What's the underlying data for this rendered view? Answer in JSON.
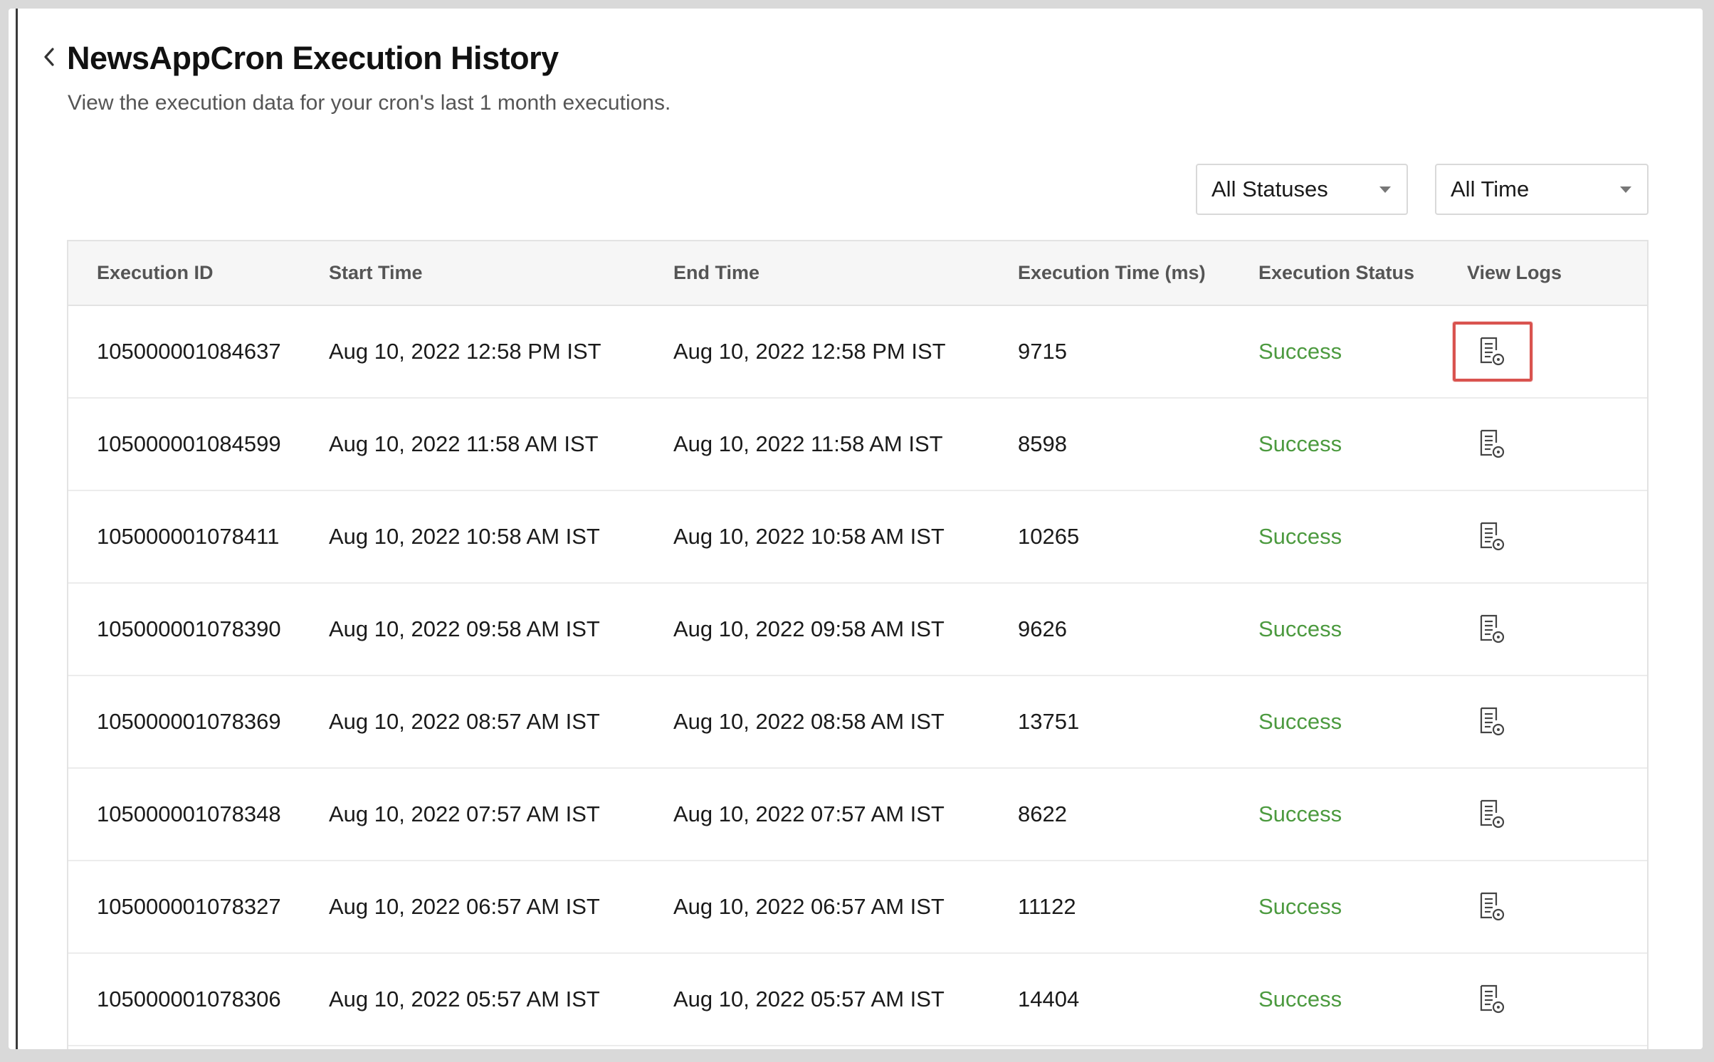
{
  "header": {
    "title": "NewsAppCron Execution History",
    "subtitle": "View the execution data for your cron's last 1 month executions."
  },
  "filters": {
    "status": {
      "selected": "All Statuses"
    },
    "time": {
      "selected": "All Time"
    }
  },
  "table": {
    "columns": [
      "Execution ID",
      "Start Time",
      "End Time",
      "Execution Time (ms)",
      "Execution Status",
      "View Logs"
    ],
    "rows": [
      {
        "id": "105000001084637",
        "start": "Aug 10, 2022 12:58 PM IST",
        "end": "Aug 10, 2022 12:58 PM IST",
        "ms": "9715",
        "status": "Success"
      },
      {
        "id": "105000001084599",
        "start": "Aug 10, 2022 11:58 AM IST",
        "end": "Aug 10, 2022 11:58 AM IST",
        "ms": "8598",
        "status": "Success"
      },
      {
        "id": "105000001078411",
        "start": "Aug 10, 2022 10:58 AM IST",
        "end": "Aug 10, 2022 10:58 AM IST",
        "ms": "10265",
        "status": "Success"
      },
      {
        "id": "105000001078390",
        "start": "Aug 10, 2022 09:58 AM IST",
        "end": "Aug 10, 2022 09:58 AM IST",
        "ms": "9626",
        "status": "Success"
      },
      {
        "id": "105000001078369",
        "start": "Aug 10, 2022 08:57 AM IST",
        "end": "Aug 10, 2022 08:58 AM IST",
        "ms": "13751",
        "status": "Success"
      },
      {
        "id": "105000001078348",
        "start": "Aug 10, 2022 07:57 AM IST",
        "end": "Aug 10, 2022 07:57 AM IST",
        "ms": "8622",
        "status": "Success"
      },
      {
        "id": "105000001078327",
        "start": "Aug 10, 2022 06:57 AM IST",
        "end": "Aug 10, 2022 06:57 AM IST",
        "ms": "11122",
        "status": "Success"
      },
      {
        "id": "105000001078306",
        "start": "Aug 10, 2022 05:57 AM IST",
        "end": "Aug 10, 2022 05:57 AM IST",
        "ms": "14404",
        "status": "Success"
      }
    ]
  },
  "icons": {
    "back": "chevron-left-icon",
    "dropdown": "caret-down-icon",
    "logs": "log-document-icon"
  },
  "colors": {
    "success": "#4c9a3f",
    "highlight": "#d9534f"
  }
}
